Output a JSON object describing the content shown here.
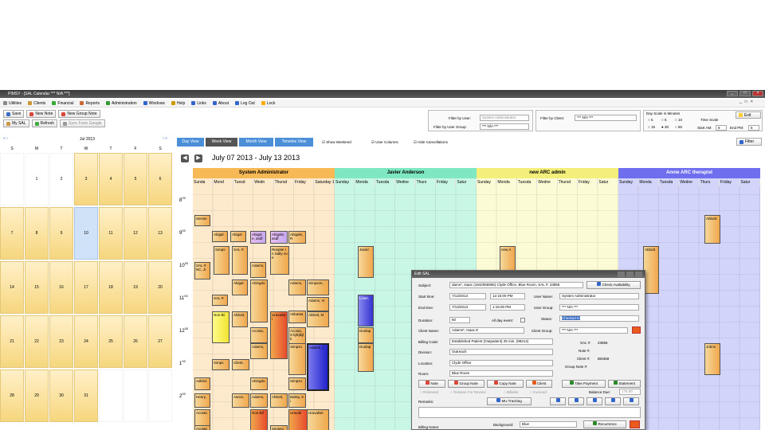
{
  "app": {
    "title": "PIMSY - [SAL Calendar  *** N/A ***]",
    "win_controls": [
      "_",
      "□",
      "×"
    ],
    "inner_controls": [
      "_",
      "□",
      "×"
    ]
  },
  "menu": [
    "Utilities",
    "Clients",
    "Financial",
    "Reports",
    "Administration",
    "Windows",
    "Help",
    "Links",
    "About",
    "Log Out",
    "Lock"
  ],
  "toolbar": {
    "save": "Save",
    "new_note": "New Note",
    "new_group_note": "New Group Note",
    "my_sal": "My SAL",
    "refresh": "Refresh",
    "sync": "Sync From Google"
  },
  "filters": {
    "filter_by_user_label": "Filter by User:",
    "filter_by_user_value": "System Administrator",
    "filter_by_group_label": "Filter by User Group:",
    "filter_by_group_value": "*** N/A ***",
    "filter_by_client_label": "Filter by Client:",
    "filter_by_client_value": "*** N/A ***",
    "day_scale_label": "Day Scale in Minutes",
    "day_scale_options": [
      "5",
      "6",
      "10",
      "15",
      "30",
      "60"
    ],
    "time_scale_label": "Time Scale",
    "start_am_label": "Start AM:",
    "start_am_value": "8",
    "end_pm_label": "End PM:",
    "end_pm_value": "5",
    "exit": "Exit",
    "filter_btn": "Filter"
  },
  "mini_calendar": {
    "month": "Jul 2013",
    "nav_prev": "« ‹",
    "nav_next": "› »",
    "dow": [
      "S",
      "M",
      "T",
      "W",
      "T",
      "F",
      "S"
    ],
    "weeks": [
      [
        "",
        "1",
        "2",
        "3",
        "4",
        "5",
        "6"
      ],
      [
        "7",
        "8",
        "9",
        "10",
        "11",
        "12",
        "13"
      ],
      [
        "14",
        "15",
        "16",
        "17",
        "18",
        "19",
        "20"
      ],
      [
        "21",
        "22",
        "23",
        "24",
        "25",
        "26",
        "27"
      ],
      [
        "28",
        "29",
        "30",
        "31",
        "",
        "",
        ""
      ]
    ],
    "today": "10"
  },
  "views": {
    "tabs": [
      "Day View",
      "Week View",
      "Month View",
      "Timeline View"
    ],
    "show_weekend": "Show Weekend",
    "user_columns": "User Columns",
    "hide_cancellations": "Hide Cancellations"
  },
  "date_range": "July 07 2013 - July 13 2013",
  "resources": [
    {
      "name": "System Administrator",
      "color": "#f7b955",
      "bg": "#fde9cc",
      "days": [
        "Sunda",
        "Mond",
        "Tuesd",
        "Wedn",
        "Thursd",
        "Friday",
        "Saturday 1"
      ]
    },
    {
      "name": "Javier Anderson",
      "color": "#7ee8c2",
      "bg": "#c9f7e6",
      "days": [
        "Sunday",
        "Monda",
        "Tuesda",
        "Wedne",
        "Thurs",
        "Friday",
        "Satur"
      ]
    },
    {
      "name": "new ARC admin",
      "color": "#f3ef7a",
      "bg": "#fbfbd5",
      "days": [
        "Sunday",
        "Monda",
        "Tuesda",
        "Wedne",
        "Thursd",
        "Friday",
        "Satur"
      ]
    },
    {
      "name": "Annie  ARC therapist",
      "color": "#6e6eee",
      "bg": "#d2d4fa",
      "days": [
        "Sunday",
        "Monda",
        "Tuesda",
        "Wedne",
        "Thurs",
        "Friday",
        "Satur"
      ]
    }
  ],
  "hours": [
    "8",
    "9",
    "10",
    "11",
    "12",
    "1",
    "2"
  ],
  "hour_sup": "00",
  "appointments": [
    "Serran",
    "Abigal",
    "Abigal",
    "Abigale, asdf",
    "Abigale, asdf",
    "Abigale, R",
    "Simps",
    "SAL #:",
    "Respite In Sally-Joe",
    "SAL #: NC, Ji",
    "Adams,",
    "Abigal",
    "Abingdo",
    "Adams,",
    "Simpson,",
    "Adams, Vi",
    "SAL #:",
    "Akbasta",
    "Bailey, Sc",
    "Non-Bi",
    "Abbott,",
    "Uravalisti",
    "Abbott, M",
    "Acosta,",
    "Acosta, S kjlkjlkjlk",
    "Adams,",
    "Simpso",
    "Adams, (",
    "Simps",
    "Client.",
    "Adkins",
    "Abingdo",
    "Simpso",
    "Henry,",
    "Aaron,",
    "Adams,",
    "Abbott,",
    "Bailey, Ki",
    "Acosta",
    "Non-Bil",
    "Uravali",
    "Uravalisti",
    "Simpso",
    "Acosta",
    "Javier",
    "Lowe,",
    "Dunlap",
    "Dunlap",
    "new A",
    "Abbott",
    "Abbott.",
    "Johns"
  ],
  "dialog": {
    "title": "Edit SAL",
    "subject_label": "Subject:",
    "subject_value": "dams*, Isaac (1842065955) Clyde Office, Blue Room, SAL #: 23855",
    "check_availability": "Check Availability",
    "start_label": "Start time:",
    "start_date": "7/13/2013",
    "start_time": "12:15:00 PM",
    "end_label": "End time:",
    "end_date": "7/13/2013",
    "end_time": "1:15:00 PM",
    "duration_label": "Duration:",
    "duration_value": "60",
    "all_day": "All day event:",
    "user_name_label": "User Name:",
    "user_name_value": "System Administrator",
    "user_group_label": "User Group:",
    "user_group_value": "*** N/A ***",
    "status_label": "Status:",
    "status_value": "Checked In",
    "client_name_label": "Client Name:",
    "client_name_value": "Adams*, Isaac E",
    "client_group_label": "Client Group:",
    "client_group_value": "*** N/A ***",
    "billing_code_label": "Billing Code:",
    "billing_code_value": "Established Patient (Outpatient) 25 min. (99214)",
    "sal_label": "SAL #:",
    "sal_value": "23855",
    "note_label": "Note #:",
    "note_value": "",
    "client_no_label": "Client #:",
    "client_no_value": "BI6358",
    "group_note_label": "Group Note #:",
    "group_note_value": "",
    "division_label": "Division:",
    "division_value": "Outreach",
    "location_label": "Location:",
    "location_value": "Clyde Office",
    "room_label": "Room:",
    "room_value": "Blue Room",
    "btn_note": "Note",
    "btn_group_note": "Group Note",
    "btn_copy_note": "Copy Note",
    "btn_client": "Client",
    "btn_take_payment": "Take Payment",
    "btn_statement": "Statement",
    "released": "Released",
    "release_review": "Release For Review",
    "billable": "Billable",
    "invoiced": "Invoiced",
    "balance_label": "Balance Due:",
    "balance_value": "175.00",
    "remarks_label": "Remarks:",
    "mu_tracking": "MU Tracking",
    "billing_notes_label": "Billing Notes:",
    "background_label": "Background:",
    "background_value": "Blue",
    "recurrence": "Recurrence"
  }
}
